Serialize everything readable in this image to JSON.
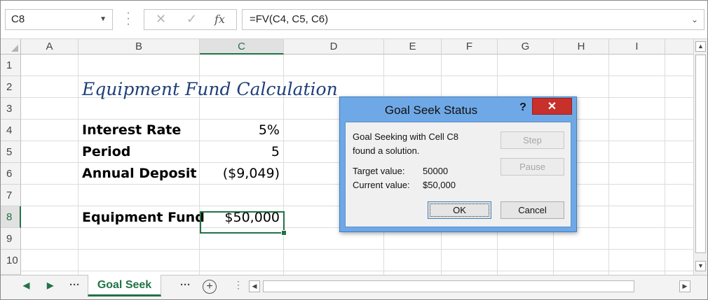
{
  "formula_bar": {
    "name_box": "C8",
    "cancel_glyph": "✕",
    "enter_glyph": "✓",
    "fx_label": "fx",
    "formula": "=FV(C4, C5, C6)"
  },
  "columns": [
    {
      "label": "A"
    },
    {
      "label": "B"
    },
    {
      "label": "C"
    },
    {
      "label": "D"
    },
    {
      "label": "E"
    },
    {
      "label": "F"
    },
    {
      "label": "G"
    },
    {
      "label": "H"
    },
    {
      "label": "I"
    }
  ],
  "selected_column": "C",
  "rows": [
    "1",
    "2",
    "3",
    "4",
    "5",
    "6",
    "7",
    "8",
    "9",
    "10"
  ],
  "selected_row": "8",
  "cells": {
    "b2": "Equipment Fund Calculation",
    "b4": "Interest Rate",
    "c4": "5%",
    "b5": "Period",
    "c5": "5",
    "b6": "Annual Deposit",
    "c6": "($9,049)",
    "b8": "Equipment Fund",
    "c8": "$50,000"
  },
  "sheet_tabs": {
    "prev": "◀",
    "next": "▶",
    "left_more": "···",
    "active": "Goal Seek",
    "right_more": "···",
    "add": "+",
    "splitter": "⋮"
  },
  "dialog": {
    "title": "Goal Seek Status",
    "help": "?",
    "close": "✕",
    "message_line1": "Goal Seeking with Cell C8",
    "message_line2": "found a solution.",
    "target_label": "Target value:",
    "target_value": "50000",
    "current_label": "Current value:",
    "current_value": "$50,000",
    "step_button": "Step",
    "pause_button": "Pause",
    "ok_button": "OK",
    "cancel_button": "Cancel"
  },
  "colors": {
    "excel_green": "#217346",
    "dialog_frame": "#6fa8e6",
    "close_red": "#c7302b",
    "title_blue": "#1f3f7a"
  }
}
